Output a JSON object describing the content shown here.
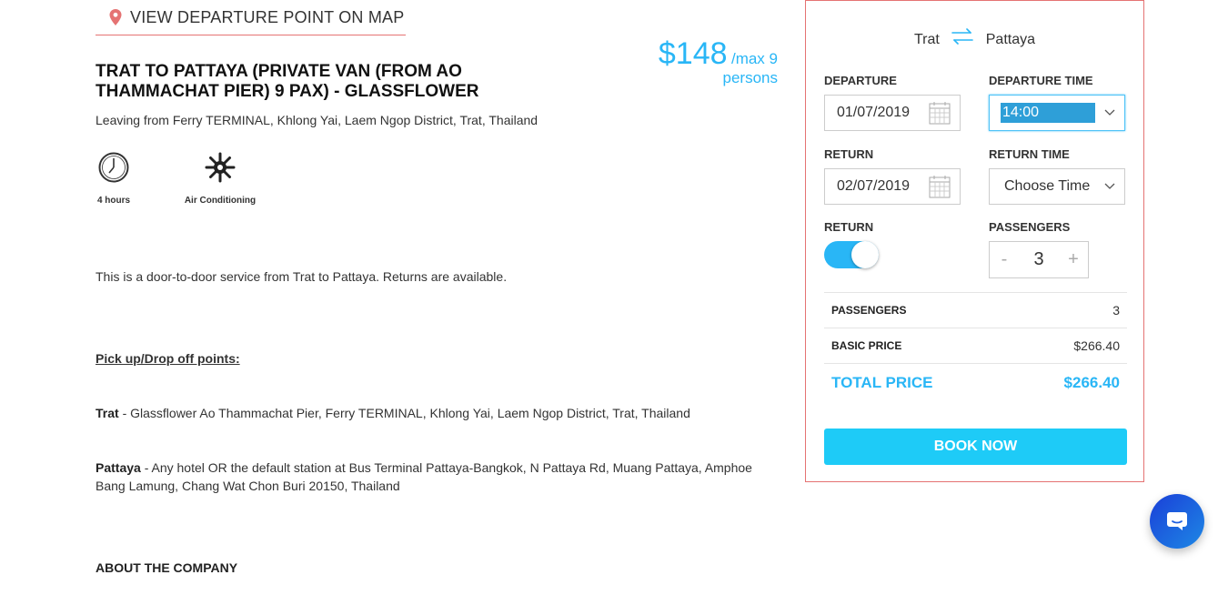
{
  "map_link": {
    "label": "VIEW DEPARTURE POINT ON MAP",
    "icon": "map-pin-icon"
  },
  "product": {
    "title": "TRAT TO PATTAYA (PRIVATE VAN (FROM AO THAMMACHAT PIER) 9 PAX) - GLASSFLOWER",
    "price": "$148",
    "price_suffix": "/max 9",
    "price_persons": "persons",
    "leaving": "Leaving from Ferry TERMINAL, Khlong Yai, Laem Ngop District, Trat, Thailand",
    "features": [
      {
        "label": "4 hours",
        "icon": "clock-icon"
      },
      {
        "label": "Air Conditioning",
        "icon": "snowflake-icon"
      }
    ],
    "description": "This is a door-to-door service from Trat to Pattaya. Returns are available.",
    "pickup_heading": "Pick up/Drop off points:",
    "points": [
      {
        "name": "Trat",
        "text": " - Glassflower Ao Thammachat Pier, Ferry TERMINAL, Khlong Yai, Laem Ngop District, Trat, Thailand"
      },
      {
        "name": "Pattaya",
        "text": " - Any hotel OR the default station at Bus Terminal Pattaya-Bangkok, N Pattaya Rd, Muang Pattaya, Amphoe Bang Lamung, Chang Wat Chon Buri 20150, Thailand"
      }
    ],
    "about_heading": "ABOUT THE COMPANY"
  },
  "booking": {
    "from": "Trat",
    "to": "Pattaya",
    "departure_label": "DEPARTURE",
    "departure_date": "01/07/2019",
    "departure_time_label": "DEPARTURE TIME",
    "departure_time": "14:00",
    "return_label": "RETURN",
    "return_date": "02/07/2019",
    "return_time_label": "RETURN TIME",
    "return_time": "Choose Time",
    "return_toggle_label": "RETURN",
    "return_toggle_on": true,
    "passengers_label": "PASSENGERS",
    "passengers_minus": "-",
    "passengers_value": "3",
    "passengers_plus": "+",
    "summary": {
      "passengers_label": "PASSENGERS",
      "passengers_value": "3",
      "basic_label": "BASIC PRICE",
      "basic_value": "$266.40",
      "total_label": "TOTAL PRICE",
      "total_value": "$266.40"
    },
    "book_label": "BOOK NOW"
  },
  "colors": {
    "accent": "#29b6f6",
    "border_red": "#e57373",
    "button": "#1ecbf7"
  }
}
